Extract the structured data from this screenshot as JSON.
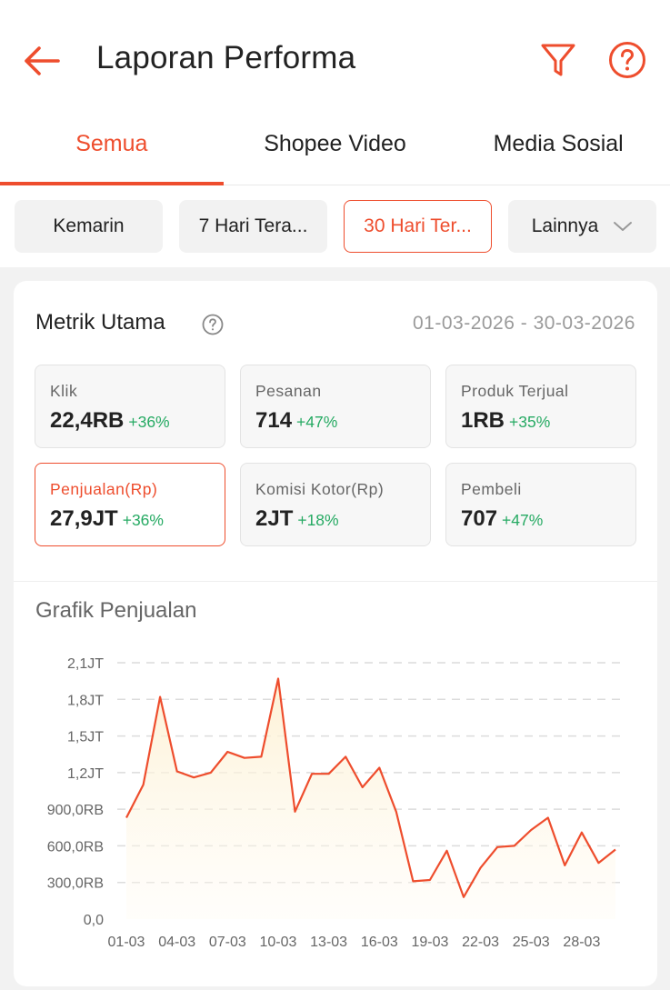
{
  "header": {
    "title": "Laporan Performa",
    "back_icon": "arrow-left-icon",
    "filter_icon": "filter-icon",
    "help_icon": "help-circle-icon"
  },
  "tabs": [
    {
      "label": "Semua",
      "active": true
    },
    {
      "label": "Shopee Video",
      "active": false
    },
    {
      "label": "Media Sosial",
      "active": false
    }
  ],
  "periods": [
    {
      "label": "Kemarin",
      "active": false
    },
    {
      "label": "7 Hari Tera...",
      "active": false
    },
    {
      "label": "30 Hari Ter...",
      "active": true
    },
    {
      "label": "Lainnya",
      "active": false,
      "dropdown": true
    }
  ],
  "metrics_card": {
    "title": "Metrik Utama",
    "date_range": "01-03-2026 - 30-03-2026",
    "metrics": [
      {
        "label": "Klik",
        "value": "22,4RB",
        "change": "+36%"
      },
      {
        "label": "Pesanan",
        "value": "714",
        "change": "+47%"
      },
      {
        "label": "Produk Terjual",
        "value": "1RB",
        "change": "+35%"
      },
      {
        "label": "Penjualan(Rp)",
        "value": "27,9JT",
        "change": "+36%",
        "active": true
      },
      {
        "label": "Komisi Kotor(Rp)",
        "value": "2JT",
        "change": "+18%"
      },
      {
        "label": "Pembeli",
        "value": "707",
        "change": "+47%"
      }
    ]
  },
  "colors": {
    "accent": "#ee4d2d",
    "positive": "#26aa63",
    "muted": "#9a9a9a"
  },
  "chart_data": {
    "type": "area",
    "title": "Grafik Penjualan",
    "y_ticks": [
      "0,0",
      "300,0RB",
      "600,0RB",
      "900,0RB",
      "1,2JT",
      "1,5JT",
      "1,8JT",
      "2,1JT"
    ],
    "ylim": [
      0,
      2100000
    ],
    "x_tick_labels": [
      "01-03",
      "04-03",
      "07-03",
      "10-03",
      "13-03",
      "16-03",
      "19-03",
      "22-03",
      "25-03",
      "28-03"
    ],
    "x": [
      "01-03",
      "02-03",
      "03-03",
      "04-03",
      "05-03",
      "06-03",
      "07-03",
      "08-03",
      "09-03",
      "10-03",
      "11-03",
      "12-03",
      "13-03",
      "14-03",
      "15-03",
      "16-03",
      "17-03",
      "18-03",
      "19-03",
      "20-03",
      "21-03",
      "22-03",
      "23-03",
      "24-03",
      "25-03",
      "26-03",
      "27-03",
      "28-03",
      "29-03",
      "30-03"
    ],
    "values": [
      830000,
      1100000,
      1820000,
      1210000,
      1160000,
      1200000,
      1370000,
      1320000,
      1330000,
      1970000,
      880000,
      1190000,
      1190000,
      1330000,
      1080000,
      1240000,
      880000,
      310000,
      320000,
      560000,
      180000,
      420000,
      590000,
      600000,
      730000,
      830000,
      440000,
      710000,
      460000,
      570000
    ],
    "grid": "horizontal dashed",
    "line_color": "#ee4d2d"
  }
}
